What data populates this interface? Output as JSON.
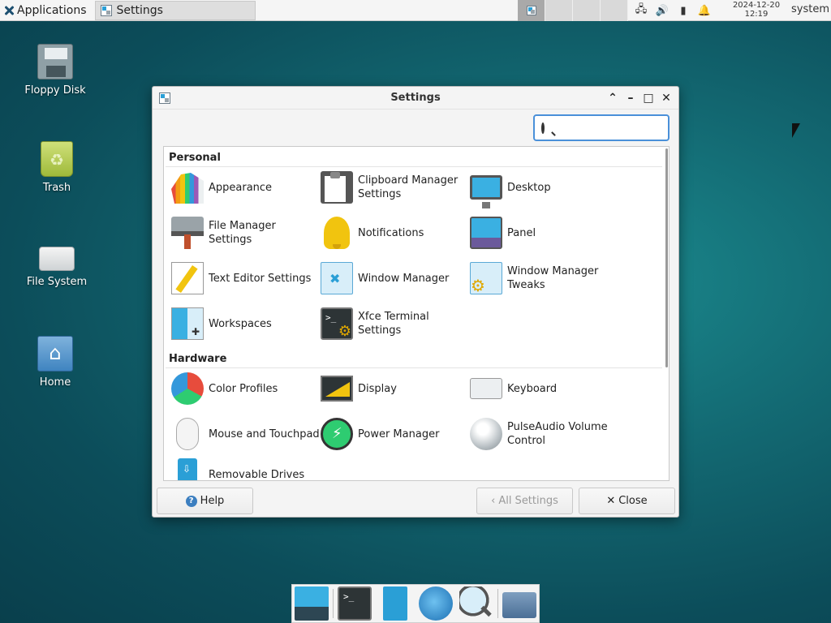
{
  "top_panel": {
    "applications_label": "Applications",
    "task_title": "Settings",
    "clock_date": "2024-12-20",
    "clock_time": "12:19",
    "user": "system"
  },
  "desktop_icons": [
    {
      "label": "Floppy Disk",
      "icon": "floppy-disk-icon"
    },
    {
      "label": "Trash",
      "icon": "trash-icon"
    },
    {
      "label": "File System",
      "icon": "hard-drive-icon"
    },
    {
      "label": "Home",
      "icon": "home-folder-icon"
    }
  ],
  "window": {
    "title": "Settings",
    "search": {
      "value": "",
      "placeholder": ""
    },
    "sections": {
      "personal": {
        "title": "Personal",
        "items": [
          {
            "label": "Appearance",
            "icon": "appearance-icon"
          },
          {
            "label": "Clipboard Manager Settings",
            "icon": "clipboard-icon"
          },
          {
            "label": "Desktop",
            "icon": "desktop-icon"
          },
          {
            "label": "File Manager Settings",
            "icon": "file-manager-icon"
          },
          {
            "label": "Notifications",
            "icon": "bell-icon"
          },
          {
            "label": "Panel",
            "icon": "panel-icon"
          },
          {
            "label": "Text Editor Settings",
            "icon": "text-editor-icon"
          },
          {
            "label": "Window Manager",
            "icon": "window-manager-icon"
          },
          {
            "label": "Window Manager Tweaks",
            "icon": "window-manager-tweaks-icon"
          },
          {
            "label": "Workspaces",
            "icon": "workspaces-icon"
          },
          {
            "label": "Xfce Terminal Settings",
            "icon": "terminal-icon"
          }
        ]
      },
      "hardware": {
        "title": "Hardware",
        "items": [
          {
            "label": "Color Profiles",
            "icon": "color-profiles-icon"
          },
          {
            "label": "Display",
            "icon": "display-icon"
          },
          {
            "label": "Keyboard",
            "icon": "keyboard-icon"
          },
          {
            "label": "Mouse and Touchpad",
            "icon": "mouse-icon"
          },
          {
            "label": "Power Manager",
            "icon": "power-icon"
          },
          {
            "label": "PulseAudio Volume Control",
            "icon": "volume-knob-icon"
          },
          {
            "label": "Removable Drives",
            "icon": "usb-drive-icon"
          }
        ]
      }
    },
    "buttons": {
      "help": "Help",
      "all_settings": "All Settings",
      "close": "Close"
    }
  },
  "dock": [
    "desktop-icon",
    "terminal-icon",
    "file-cabinet-icon",
    "web-browser-icon",
    "app-finder-icon",
    "folder-icon"
  ]
}
